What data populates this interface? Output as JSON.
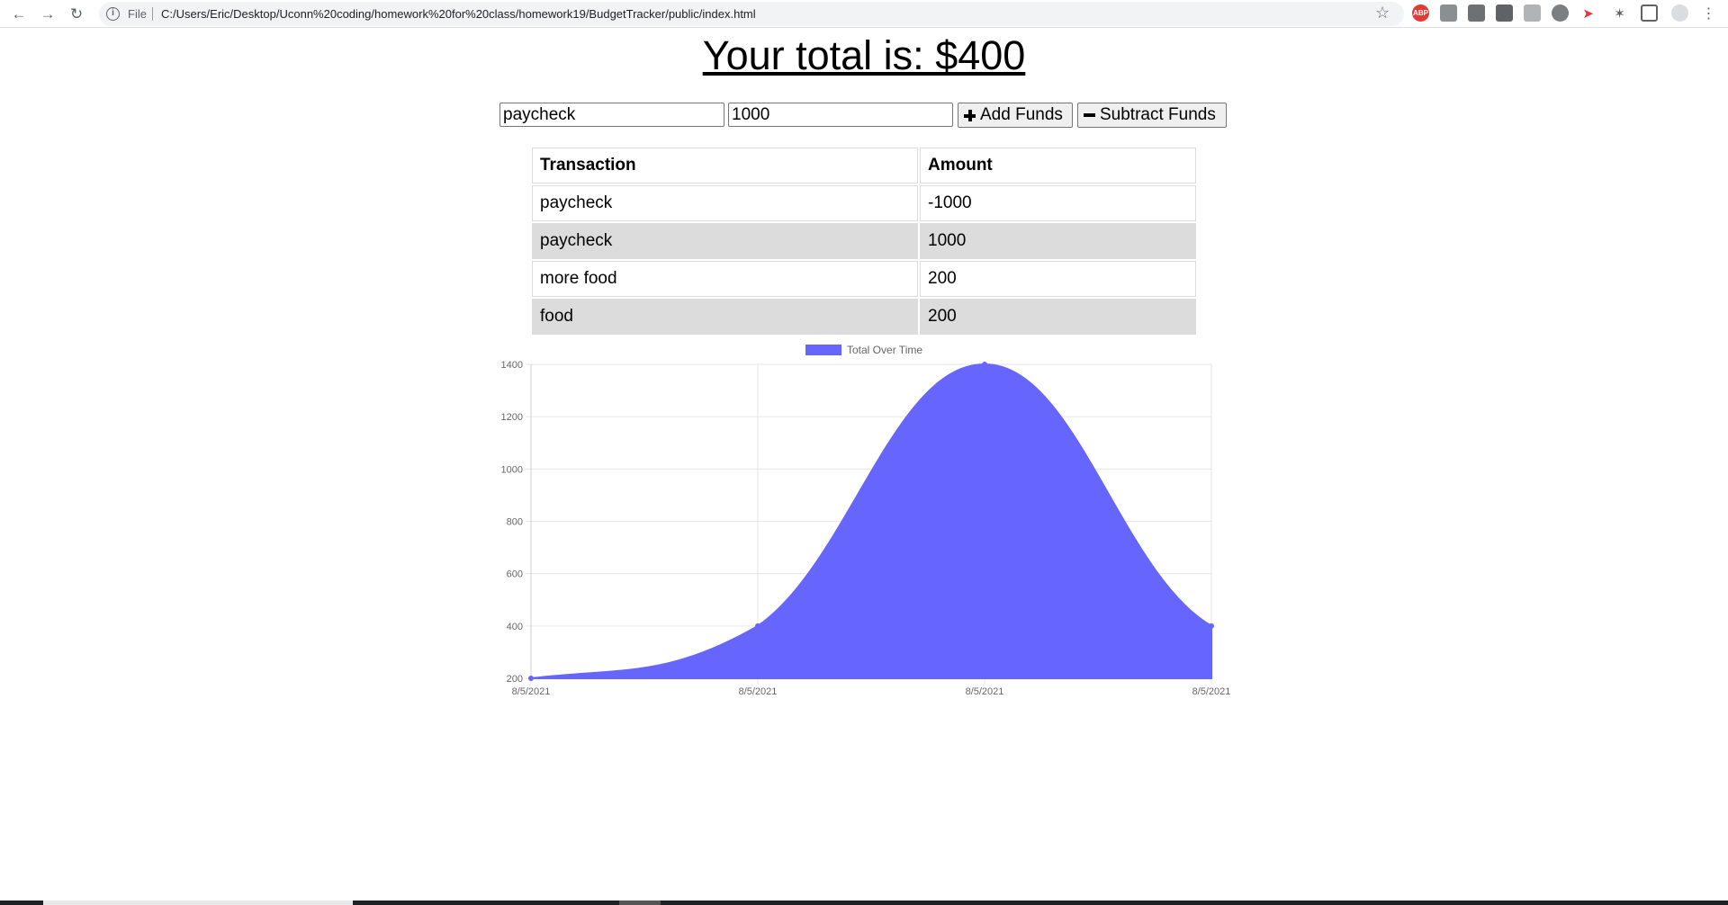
{
  "browser": {
    "scheme_label": "File",
    "url": "C:/Users/Eric/Desktop/Uconn%20coding/homework%20for%20class/homework19/BudgetTracker/public/index.html"
  },
  "page": {
    "title": "Your total is: $400",
    "name_input_value": "paycheck",
    "amount_input_value": "1000",
    "add_button_label": "Add Funds",
    "subtract_button_label": "Subtract Funds"
  },
  "table": {
    "headers": [
      "Transaction",
      "Amount"
    ],
    "rows": [
      {
        "name": "paycheck",
        "amount": "-1000"
      },
      {
        "name": "paycheck",
        "amount": "1000"
      },
      {
        "name": "more food",
        "amount": "200"
      },
      {
        "name": "food",
        "amount": "200"
      }
    ]
  },
  "chart_data": {
    "type": "area",
    "categories": [
      "8/5/2021",
      "8/5/2021",
      "8/5/2021",
      "8/5/2021"
    ],
    "series": [
      {
        "name": "Total Over Time",
        "values": [
          200,
          400,
          1400,
          400
        ],
        "color": "#6666ff"
      }
    ],
    "ylim": [
      200,
      1400
    ],
    "yticks": [
      200,
      400,
      600,
      800,
      1000,
      1200,
      1400
    ],
    "legend": "top",
    "grid": true
  }
}
